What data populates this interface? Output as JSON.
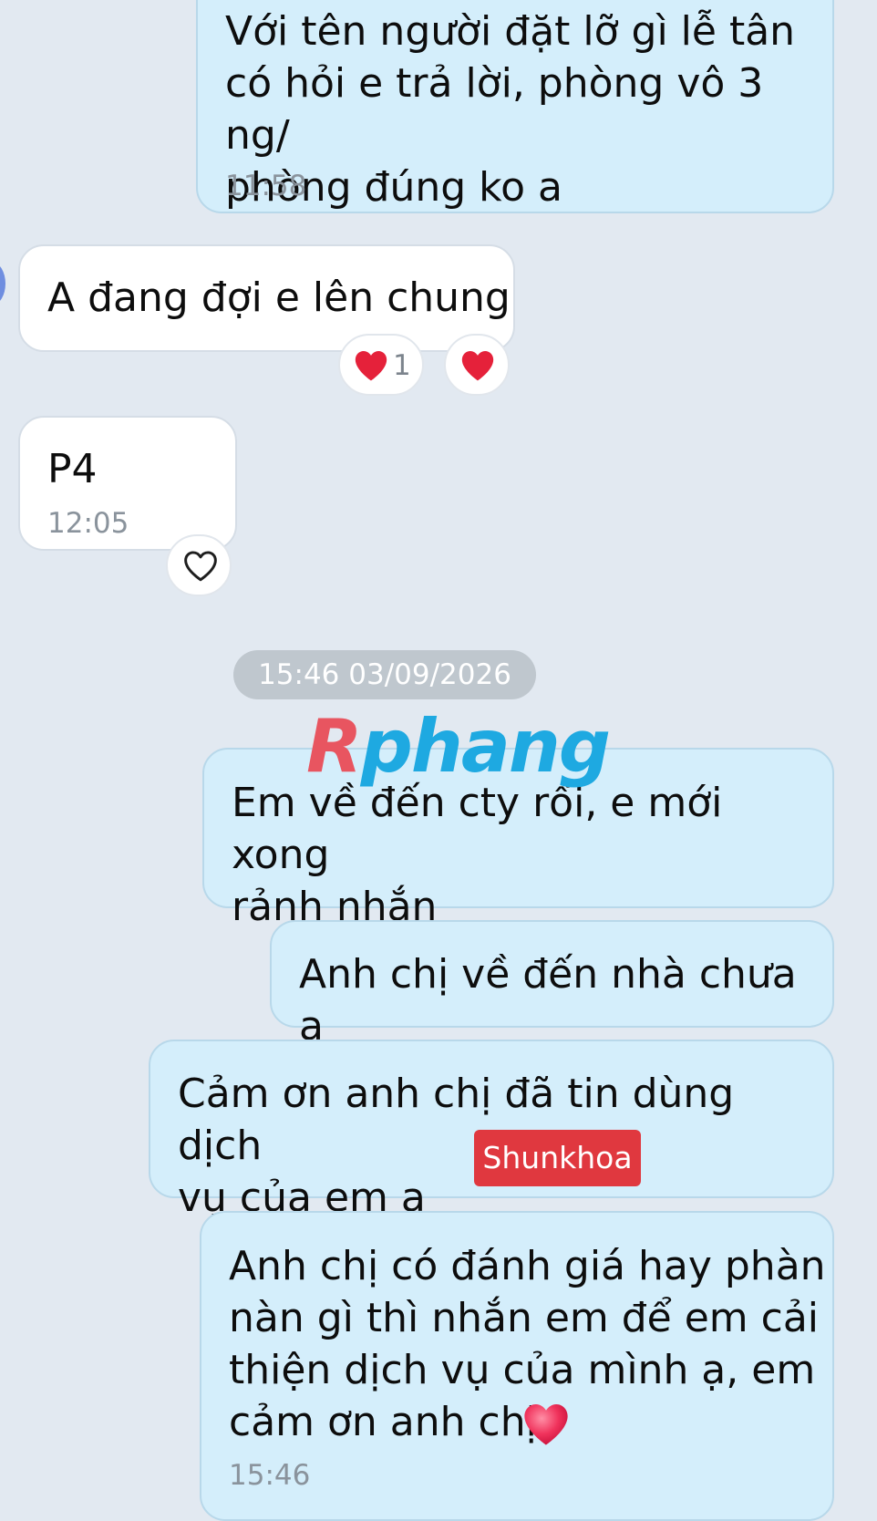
{
  "messages": [
    {
      "direction": "out",
      "text": "Với tên người đặt lỡ gì lễ tân\ncó hỏi e trả lời, phòng vô 3 ng/\nphòng đúng ko a",
      "time": "11:58"
    },
    {
      "direction": "in",
      "text": "A đang đợi e lên chung",
      "reactions": {
        "count": "1"
      }
    },
    {
      "direction": "in",
      "text": "P4",
      "time": "12:05"
    },
    {
      "direction": "out",
      "text": "Em về đến cty rồi, e mới xong\nrảnh nhắn"
    },
    {
      "direction": "out",
      "text": "Anh chị về đến nhà chưa ạ"
    },
    {
      "direction": "out",
      "text": "Cảm ơn anh chị đã tin dùng dịch\nvụ của em ạ"
    },
    {
      "direction": "out",
      "text": "Anh chị có đánh giá hay phàn\nnàn gì thì nhắn em để em cải\nthiện dịch vụ của mình ạ, em\ncảm ơn anh chị",
      "time": "15:46",
      "trailing_emoji": "heart"
    }
  ],
  "date_separator": "15:46 03/09/2026",
  "watermark": {
    "first": "R",
    "rest": "phang"
  },
  "overlay_tag": "Shunkhoa",
  "colors": {
    "background": "#e2e9f1",
    "outgoing_bubble": "#d4eefb",
    "incoming_bubble": "#ffffff",
    "heart": "#e5213a",
    "tag": "#e0383f"
  }
}
